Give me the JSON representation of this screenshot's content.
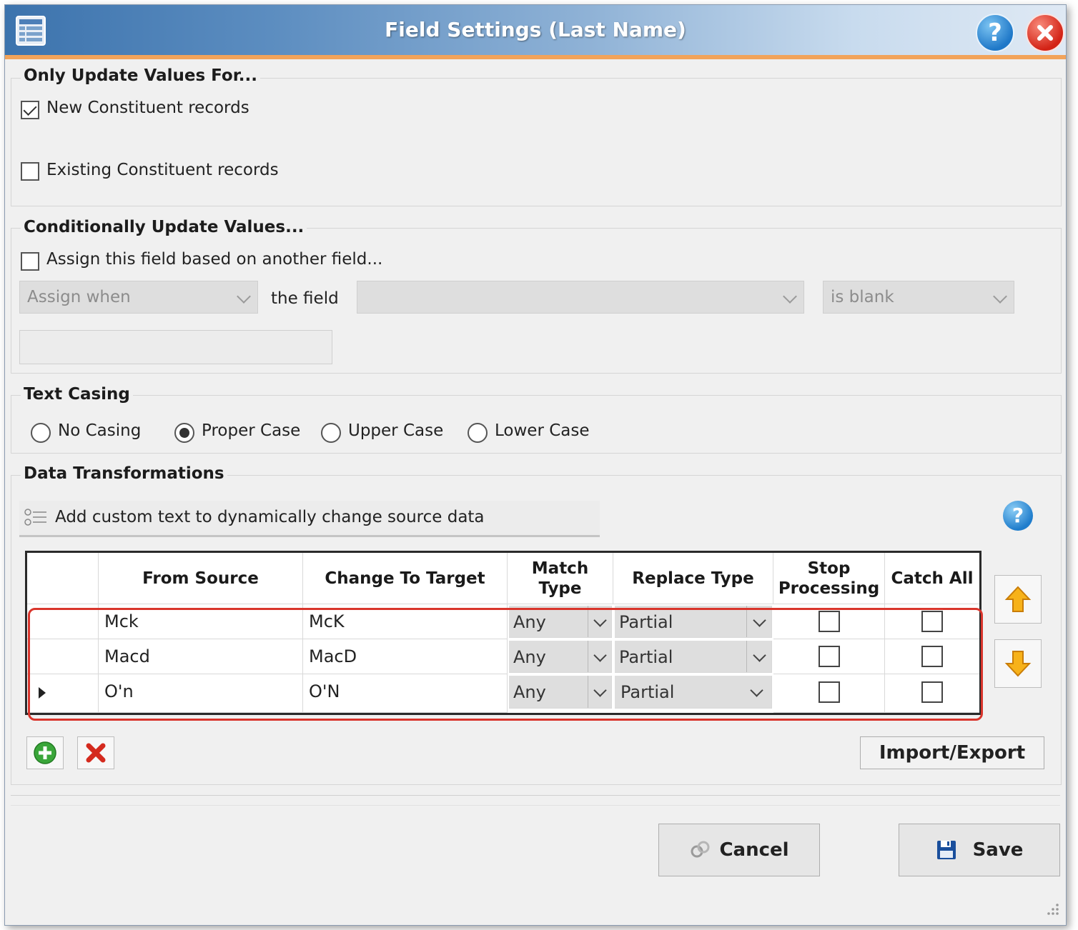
{
  "window": {
    "title": "Field Settings (Last Name)",
    "icons": {
      "app": "list-window-icon",
      "help": "help-icon",
      "close": "close-icon"
    }
  },
  "only_update": {
    "title": "Only Update Values For...",
    "new_constituent": {
      "label": "New Constituent records",
      "checked": true
    },
    "existing_constituent": {
      "label": "Existing Constituent records",
      "checked": false
    }
  },
  "conditional": {
    "title": "Conditionally Update Values...",
    "assign_checkbox": {
      "label": "Assign this field based on another field...",
      "checked": false
    },
    "assign_when": "Assign when",
    "the_field_label": "the field",
    "field_value": "",
    "condition": "is blank",
    "value_text": ""
  },
  "text_casing": {
    "title": "Text Casing",
    "options": [
      "No Casing",
      "Proper Case",
      "Upper Case",
      "Lower Case"
    ],
    "selected": "Proper Case"
  },
  "data_transformations": {
    "title": "Data Transformations",
    "add_custom_text": "Add custom text to dynamically change source data",
    "columns": {
      "from_source": "From Source",
      "change_to_target": "Change To Target",
      "match_type_1": "Match",
      "match_type_2": "Type",
      "replace_type": "Replace Type",
      "stop_processing_1": "Stop",
      "stop_processing_2": "Processing",
      "catch_all": "Catch All"
    },
    "rows": [
      {
        "from": "Mck",
        "to": "McK",
        "match": "Any",
        "replace": "Partial",
        "stop": false,
        "catch_all": false,
        "current": false
      },
      {
        "from": "Macd",
        "to": "MacD",
        "match": "Any",
        "replace": "Partial",
        "stop": false,
        "catch_all": false,
        "current": false
      },
      {
        "from": "O'n",
        "to": "O'N",
        "match": "Any",
        "replace": "Partial",
        "stop": false,
        "catch_all": false,
        "current": true
      }
    ],
    "import_export": "Import/Export"
  },
  "footer": {
    "cancel": "Cancel",
    "save": "Save"
  },
  "colors": {
    "title_gradient_start": "#3c73ad",
    "title_accent": "#f2a35a",
    "highlight": "#d9352c"
  }
}
